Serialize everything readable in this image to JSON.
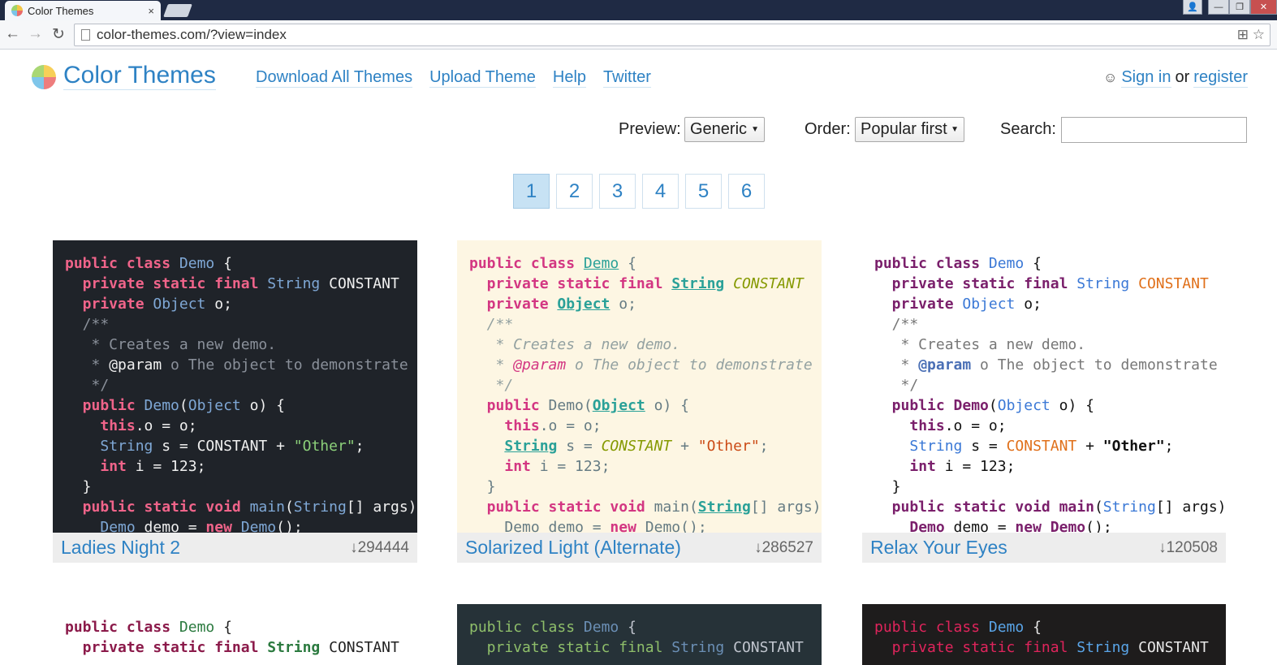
{
  "browser": {
    "tab_title": "Color Themes",
    "tab_close": "×",
    "url": "color-themes.com/?view=index",
    "controls": {
      "back": "←",
      "forward": "→",
      "reload": "↻",
      "extensions": "⊞ ☆",
      "min": "—",
      "max": "❐",
      "close": "✕",
      "user": "👤"
    }
  },
  "header": {
    "brand": "Color Themes",
    "nav": [
      "Download All Themes",
      "Upload Theme",
      "Help",
      "Twitter"
    ],
    "auth": {
      "sign_in": "Sign in",
      "or": "or",
      "register": "register"
    }
  },
  "filters": {
    "preview_label": "Preview:",
    "preview_value": "Generic",
    "order_label": "Order:",
    "order_value": "Popular first",
    "search_label": "Search:",
    "search_value": ""
  },
  "pagination": {
    "pages": [
      "1",
      "2",
      "3",
      "4",
      "5",
      "6"
    ],
    "active": "1"
  },
  "themes": [
    {
      "name": "Ladies Night 2",
      "downloads": "↓294444"
    },
    {
      "name": "Solarized Light (Alternate)",
      "downloads": "↓286527"
    },
    {
      "name": "Relax Your Eyes",
      "downloads": "↓120508"
    }
  ],
  "code": {
    "l1": [
      "public class ",
      "Demo",
      " {"
    ],
    "l2": [
      "  private static final ",
      "String",
      " CONSTANT"
    ],
    "l3": [
      "  private ",
      "Object",
      " o;"
    ],
    "l4": "  /**",
    "l5": "   * Creates a new demo.",
    "l6": [
      "   * ",
      "@param",
      " o The object to demonstrate"
    ],
    "l7": "   */",
    "l8": [
      "  public ",
      "Demo",
      "(",
      "Object",
      " o) {"
    ],
    "l9": [
      "    ",
      "this",
      ".o = o;"
    ],
    "l10": [
      "    ",
      "String",
      " s = ",
      "CONSTANT",
      " + ",
      "\"Other\"",
      ";"
    ],
    "l11": [
      "    ",
      "int",
      " i = 123;"
    ],
    "l12": "  }",
    "l13": [
      "  public static void ",
      "main",
      "(",
      "String",
      "[] args) {"
    ],
    "l14": [
      "    ",
      "Demo",
      " demo = ",
      "new",
      " ",
      "Demo",
      "();"
    ]
  }
}
